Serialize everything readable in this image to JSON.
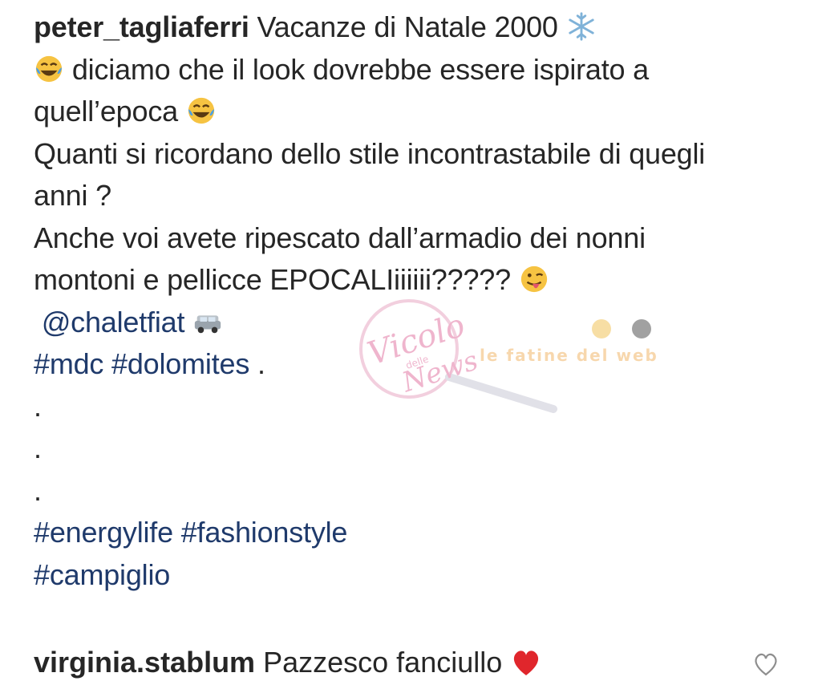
{
  "post": {
    "username": "peter_tagliaferri",
    "caption_line1": "Vacanze di Natale 2000",
    "caption_line2": " diciamo che il look dovrebbe essere ispirato a",
    "caption_line3": "quell’epoca ",
    "caption_line4": "Quanti si ricordano dello stile incontrastabile di quegli",
    "caption_line5": "anni ?",
    "caption_line6": "Anche voi avete ripescato dall’armadio dei nonni",
    "caption_line7": "montoni e pellicce EPOCALIiiiiii????? ",
    "mention": "@chaletfiat",
    "hashtags_line1": "#mdc #dolomites",
    "hashtags_line1_suffix": " .",
    "dot": ".",
    "hashtags_line2": "#energylife #fashionstyle",
    "hashtags_line3": "#campiglio"
  },
  "comment": {
    "username": "virginia.stablum",
    "text": "Pazzesco fanciullo"
  },
  "watermark": {
    "title": "Vicolo",
    "small": "delle",
    "word": "News",
    "tagline": "le fatine del web"
  },
  "icons": {
    "snowflake": "snowflake-icon",
    "laughing": "tears-of-joy-icon",
    "wink_tongue": "winking-tongue-icon",
    "car": "car-icon",
    "heart": "red-heart-icon",
    "like": "like-heart-outline-icon"
  },
  "colors": {
    "text": "#262626",
    "hashtag": "#1f3a6b",
    "heart": "#e0262c"
  }
}
